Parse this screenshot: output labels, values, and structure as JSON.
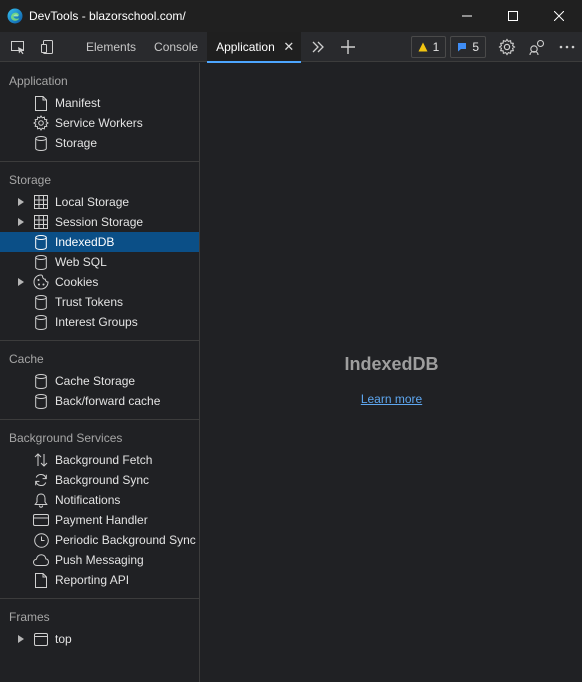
{
  "window": {
    "title": "DevTools - blazorschool.com/",
    "app_icon": "edge-logo-icon"
  },
  "toolbar": {
    "tabs": [
      {
        "label": "Elements"
      },
      {
        "label": "Console"
      },
      {
        "label": "Application",
        "active": true
      }
    ],
    "warnings_count": "1",
    "issues_count": "5"
  },
  "sidebar": {
    "sections": [
      {
        "title": "Application",
        "items": [
          {
            "label": "Manifest",
            "icon": "file-icon"
          },
          {
            "label": "Service Workers",
            "icon": "gear-icon"
          },
          {
            "label": "Storage",
            "icon": "database-icon"
          }
        ]
      },
      {
        "title": "Storage",
        "items": [
          {
            "label": "Local Storage",
            "icon": "grid-icon",
            "expandable": true
          },
          {
            "label": "Session Storage",
            "icon": "grid-icon",
            "expandable": true
          },
          {
            "label": "IndexedDB",
            "icon": "database-icon",
            "selected": true
          },
          {
            "label": "Web SQL",
            "icon": "database-icon"
          },
          {
            "label": "Cookies",
            "icon": "cookie-icon",
            "expandable": true
          },
          {
            "label": "Trust Tokens",
            "icon": "database-icon"
          },
          {
            "label": "Interest Groups",
            "icon": "database-icon"
          }
        ]
      },
      {
        "title": "Cache",
        "items": [
          {
            "label": "Cache Storage",
            "icon": "database-icon"
          },
          {
            "label": "Back/forward cache",
            "icon": "database-icon"
          }
        ]
      },
      {
        "title": "Background Services",
        "items": [
          {
            "label": "Background Fetch",
            "icon": "up-down-arrows-icon"
          },
          {
            "label": "Background Sync",
            "icon": "sync-icon"
          },
          {
            "label": "Notifications",
            "icon": "bell-icon"
          },
          {
            "label": "Payment Handler",
            "icon": "credit-card-icon"
          },
          {
            "label": "Periodic Background Sync",
            "icon": "clock-icon"
          },
          {
            "label": "Push Messaging",
            "icon": "cloud-icon"
          },
          {
            "label": "Reporting API",
            "icon": "file-icon"
          }
        ]
      },
      {
        "title": "Frames",
        "items": [
          {
            "label": "top",
            "icon": "frame-icon",
            "expandable": true
          }
        ]
      }
    ]
  },
  "main": {
    "heading": "IndexedDB",
    "link": "Learn more"
  },
  "colors": {
    "accent": "#4da6ff",
    "selected_bg": "#0b4f87",
    "link": "#5ea7f0",
    "warning": "#f2c511",
    "issue": "#3f8df5"
  }
}
